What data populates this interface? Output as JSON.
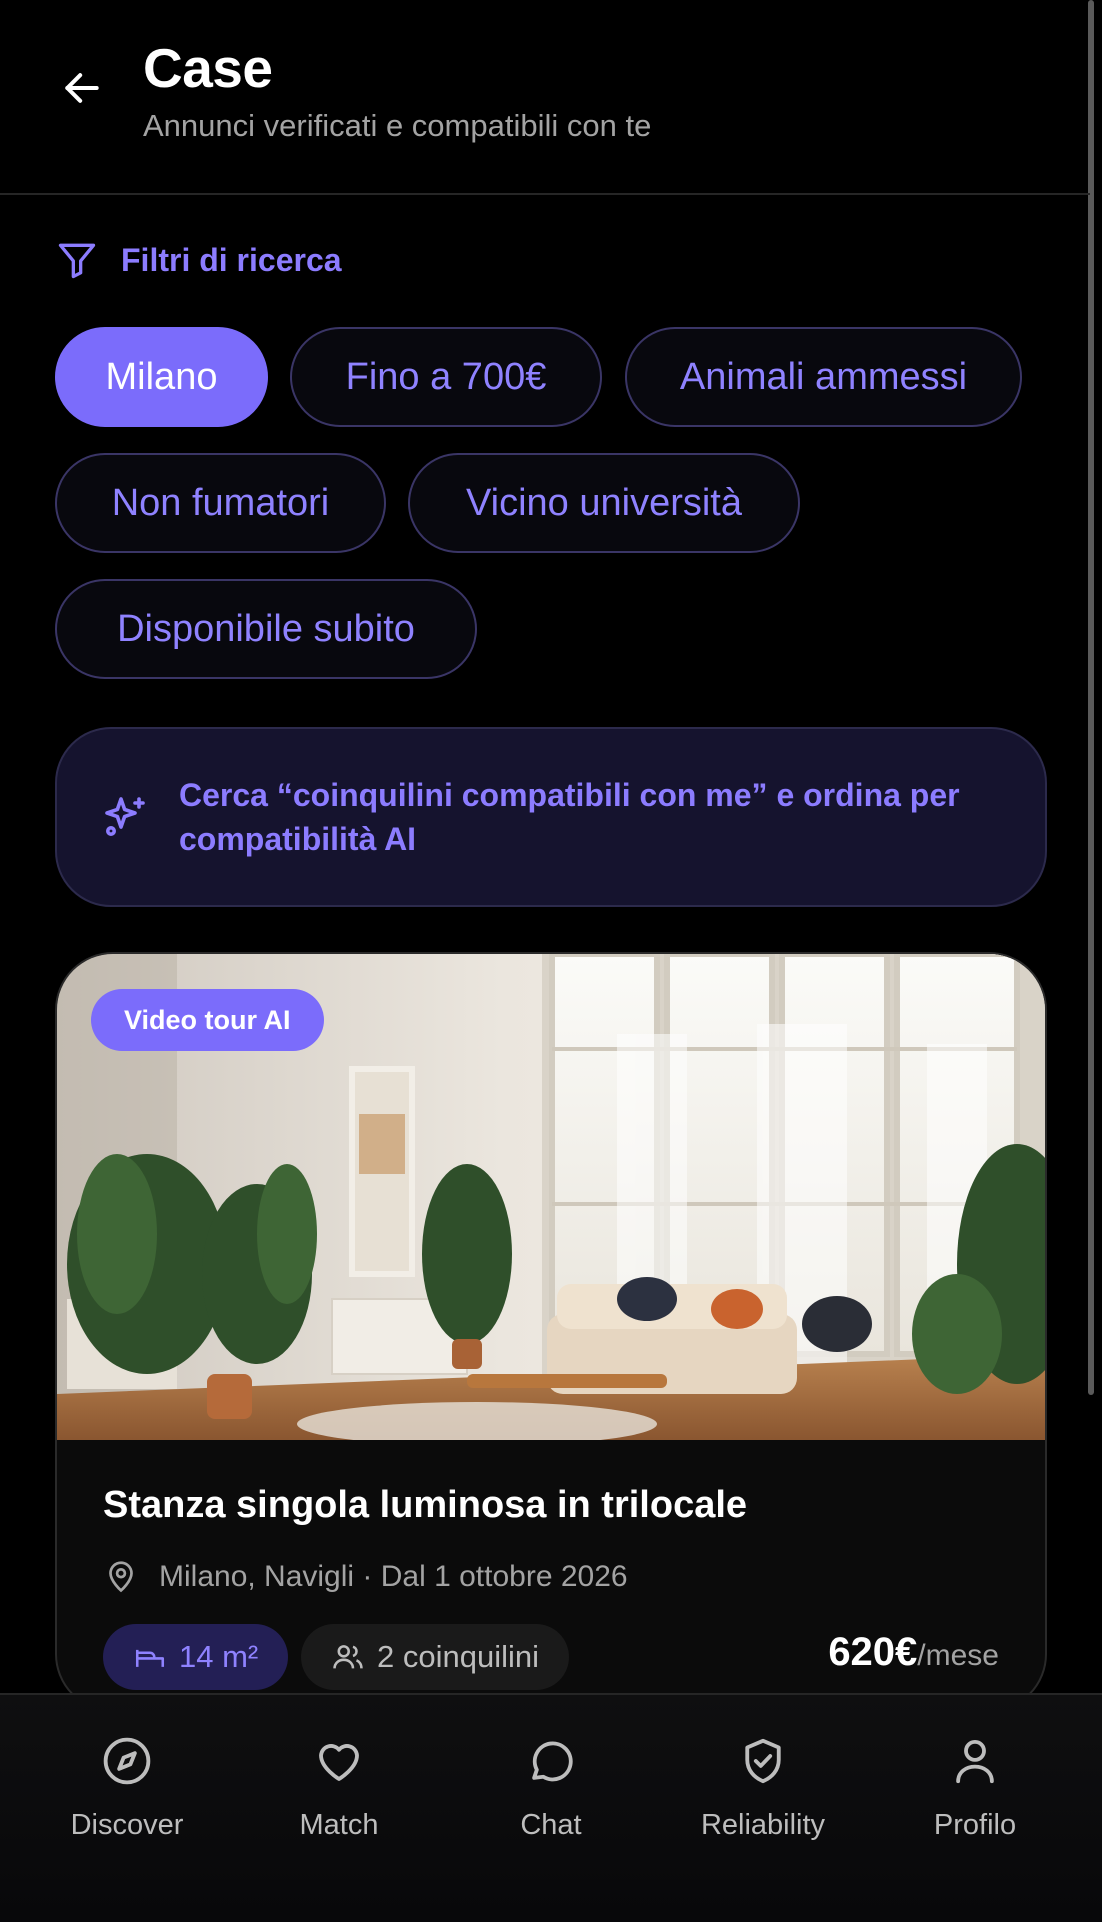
{
  "header": {
    "back_icon": "arrow-left-icon",
    "title": "Case",
    "subtitle": "Annunci verificati e compatibili con te"
  },
  "filters": {
    "icon": "filter-funnel-icon",
    "heading": "Filtri di ricerca",
    "accent_color": "#7b6cfb",
    "chips": [
      {
        "label": "Milano",
        "active": true
      },
      {
        "label": "Fino a 700€",
        "active": false
      },
      {
        "label": "Animali ammessi",
        "active": false
      },
      {
        "label": "Non fumatori",
        "active": false
      },
      {
        "label": "Vicino università",
        "active": false
      },
      {
        "label": "Disponibile subito",
        "active": false
      }
    ]
  },
  "ai_banner": {
    "icon": "sparkles-icon",
    "text": "Cerca “coinquilini compatibili con me” e ordina per compatibilità AI"
  },
  "listing": {
    "badge": "Video tour AI",
    "title": "Stanza singola luminosa in trilocale",
    "location_icon": "map-pin-icon",
    "location": "Milano, Navigli · Dal 1 ottobre 2026",
    "size_icon": "bed-icon",
    "size": "14 m²",
    "roommates_icon": "users-icon",
    "roommates": "2 coinquilini",
    "price": "620€",
    "price_unit": "/mese"
  },
  "nav": {
    "items": [
      {
        "label": "Discover",
        "icon": "compass-icon"
      },
      {
        "label": "Match",
        "icon": "heart-icon"
      },
      {
        "label": "Chat",
        "icon": "chat-bubble-icon"
      },
      {
        "label": "Reliability",
        "icon": "shield-check-icon"
      },
      {
        "label": "Profilo",
        "icon": "user-icon"
      }
    ]
  }
}
